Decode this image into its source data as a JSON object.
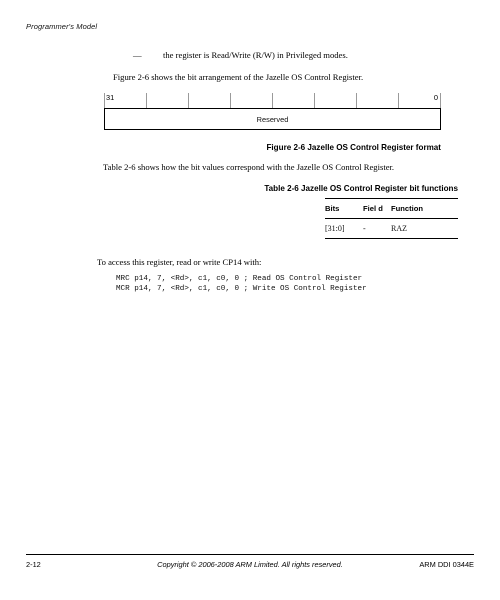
{
  "header": {
    "running_title": "Programmer's Model"
  },
  "content": {
    "bullet_dash": "—",
    "bullet_text": "the register is Read/Write (R/W) in Privileged modes.",
    "figure_intro": "Figure 2-6 shows the bit arrangement of the Jazelle OS Control Register.",
    "table_intro": "Table 2-6 shows how the bit values correspond with the Jazelle OS Control Register.",
    "access_intro": "To access this register, read or write CP14 with:"
  },
  "register_figure": {
    "bit_high_label": "31",
    "bit_low_label": "0",
    "field_label": "Reserved",
    "tick_count": 9,
    "caption": "Figure 2-6 Jazelle OS Control Register format"
  },
  "bit_table": {
    "caption": "Table 2-6 Jazelle OS Control Register bit functions",
    "columns": [
      "Bits",
      "Fiel d",
      "Function"
    ],
    "rows": [
      {
        "bits": "[31:0]",
        "field": "-",
        "function": "RAZ"
      }
    ]
  },
  "code": {
    "lines": [
      "MRC p14, 7, <Rd>, c1, c0, 0 ; Read OS Control Register",
      "MCR p14, 7, <Rd>, c1, c0, 0 ; Write OS Control Register"
    ],
    "text": "MRC p14, 7, <Rd>, c1, c0, 0 ; Read OS Control Register\nMCR p14, 7, <Rd>, c1, c0, 0 ; Write OS Control Register"
  },
  "footer": {
    "page_number": "2-12",
    "copyright": "Copyright © 2006-2008 ARM Limited. All rights reserved.",
    "document_id": "ARM DDI 0344E"
  },
  "colors": {
    "text": "#000000",
    "rule": "#000000",
    "tick": "#9a9a9a",
    "background": "#ffffff"
  }
}
